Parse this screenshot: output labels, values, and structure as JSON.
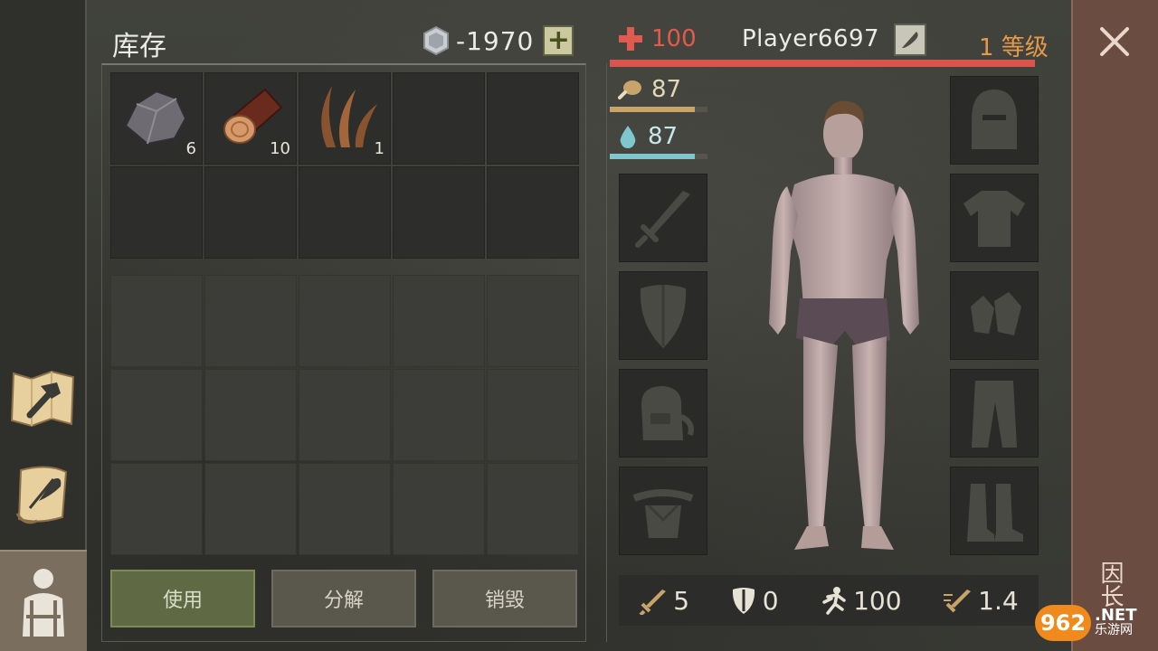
{
  "inventory": {
    "title": "库存",
    "currency_value": "-1970",
    "add_label": "+",
    "items": [
      {
        "name": "stone",
        "count": "6"
      },
      {
        "name": "log",
        "count": "10"
      },
      {
        "name": "plant fiber",
        "count": "1"
      }
    ],
    "buttons": {
      "use": "使用",
      "decompose": "分解",
      "destroy": "销毁"
    }
  },
  "character": {
    "health": "100",
    "player_name": "Player6697",
    "level": "1 等级",
    "food": "87",
    "water": "87",
    "food_fraction": 0.87,
    "water_fraction": 0.87,
    "stats": {
      "attack": "5",
      "defense": "0",
      "speed": "100",
      "attack_speed": "1.4"
    }
  },
  "side": {
    "label": "因长"
  },
  "watermark": {
    "logo": "962",
    "suffix": ".NET",
    "sub": "乐游网"
  },
  "colors": {
    "health": "#e05a4f",
    "food_bar": "#c8a46a",
    "water_bar": "#7fc6cf",
    "level": "#e59a4a",
    "use_button": "#5f6a45"
  }
}
